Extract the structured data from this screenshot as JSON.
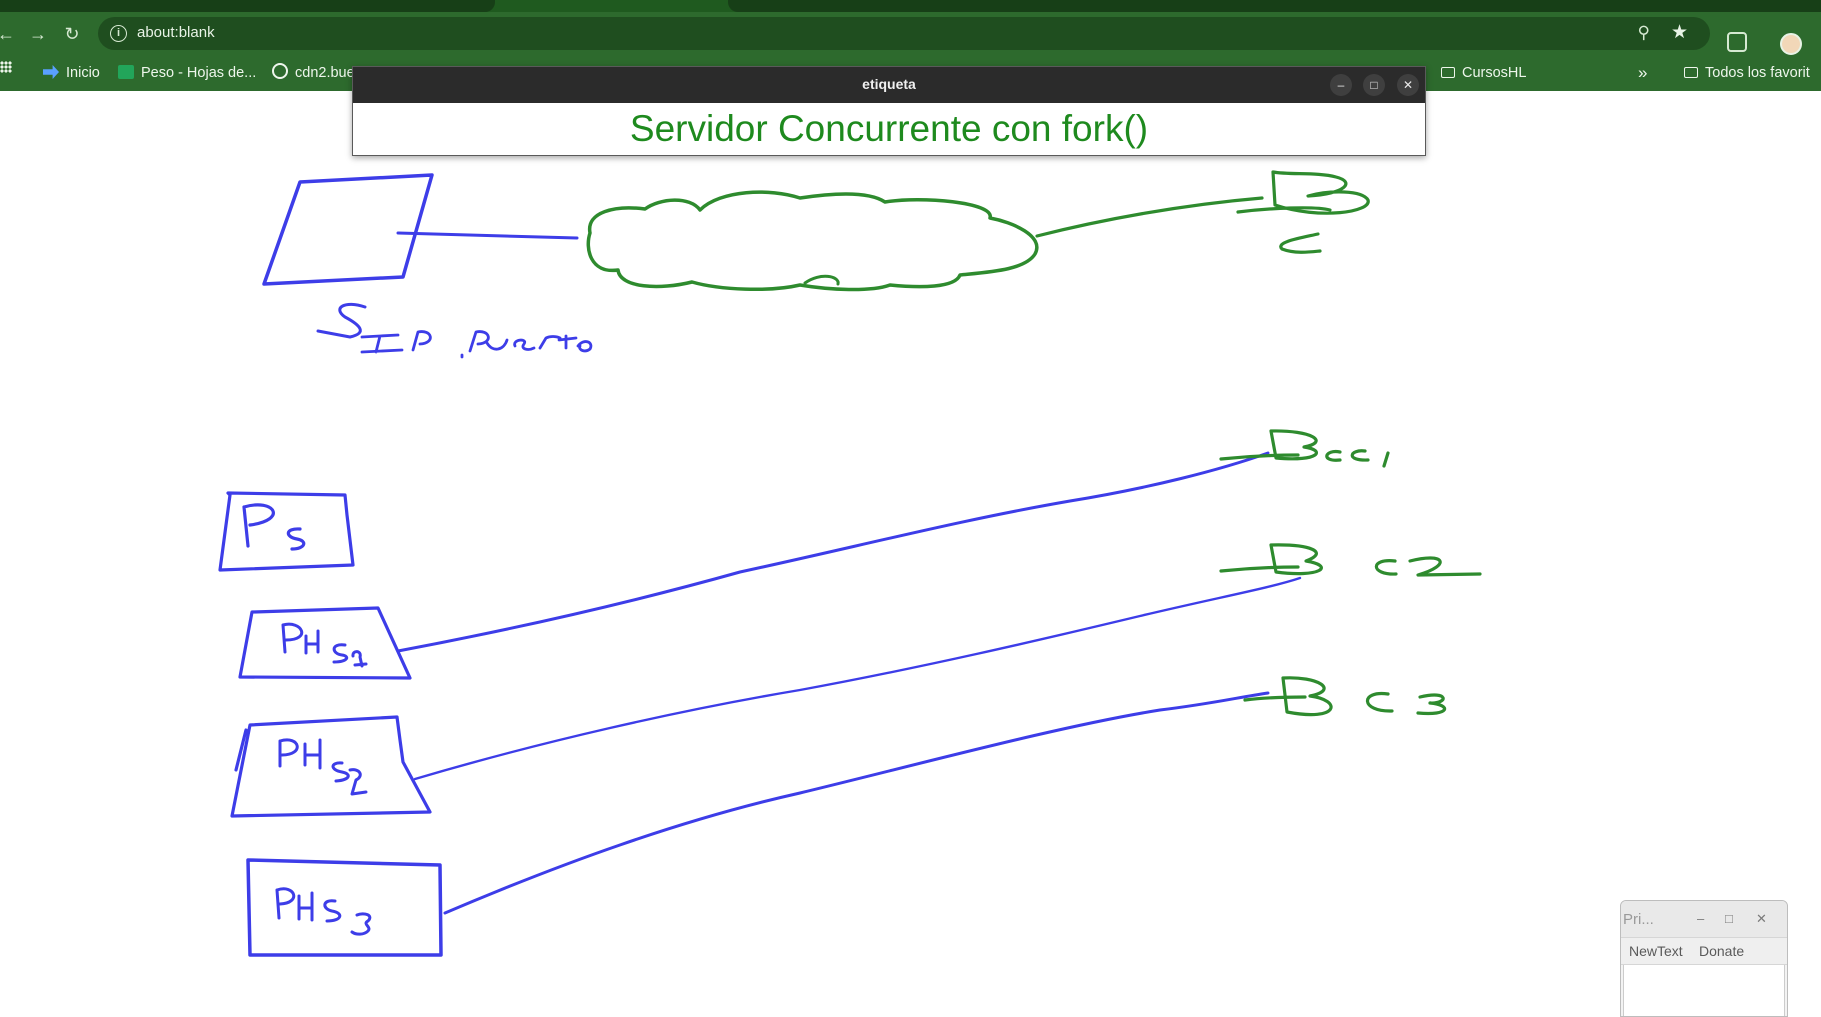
{
  "browser": {
    "url": "about:blank",
    "bookmarks": [
      {
        "label": "Inicio"
      },
      {
        "label": "Peso - Hojas de..."
      },
      {
        "label": "cdn2.bue"
      },
      {
        "label": "CursosHL"
      },
      {
        "label": "Todos los favorit"
      }
    ],
    "overflow_label": "»"
  },
  "label_window": {
    "title": "etiqueta",
    "text": "Servidor Concurrente con fork()"
  },
  "tool_window": {
    "title": "Pri...",
    "menu": [
      "NewText",
      "Donate"
    ]
  },
  "colors": {
    "chrome_green": "#2d6a2d",
    "ink_blue": "#3d3de8",
    "ink_green": "#2e8b2e",
    "title_green": "#1e8a1e"
  }
}
